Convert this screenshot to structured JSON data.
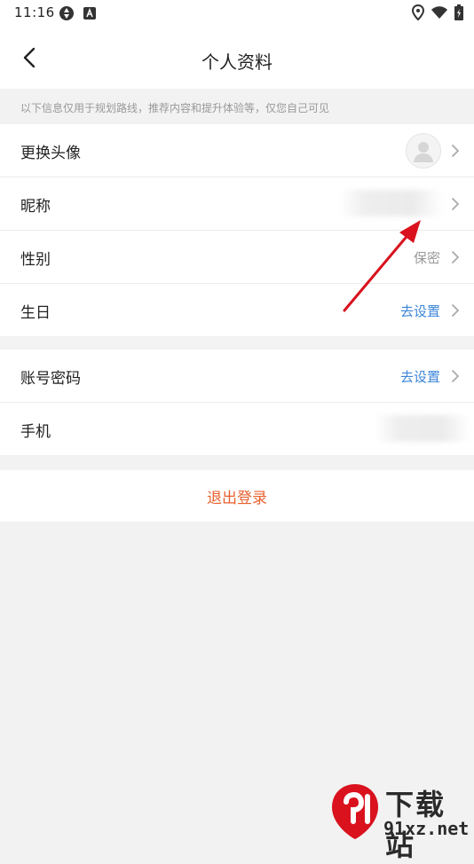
{
  "status_bar": {
    "time": "11:16",
    "left_icons": [
      "sync-icon",
      "a-badge-icon"
    ],
    "right_icons": [
      "location-icon",
      "wifi-icon",
      "battery-icon"
    ]
  },
  "nav": {
    "title": "个人资料",
    "back_icon": "chevron-left-icon"
  },
  "notice": "以下信息仅用于规划路线，推荐内容和提升体验等，仅您自己可见",
  "profile_rows": [
    {
      "label": "更换头像"
    },
    {
      "label": "昵称"
    },
    {
      "label": "性别",
      "value": "保密"
    },
    {
      "label": "生日",
      "value": "去设置"
    }
  ],
  "account_rows": [
    {
      "label": "账号密码",
      "value": "去设置"
    },
    {
      "label": "手机"
    }
  ],
  "logout_label": "退出登录",
  "colors": {
    "accent_link": "#3b86d9",
    "logout": "#e9612f",
    "annotation_arrow": "#d9121e"
  },
  "watermark": {
    "brand_name": "下载站",
    "brand_url": "91xz.net"
  }
}
